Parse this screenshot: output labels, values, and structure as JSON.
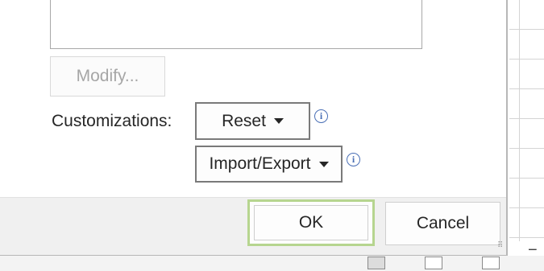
{
  "dialog": {
    "modify_button": "Modify...",
    "customizations_label": "Customizations:",
    "reset_button": "Reset",
    "import_export_button": "Import/Export",
    "ok_button": "OK",
    "cancel_button": "Cancel"
  },
  "icons": {
    "info": "info-icon",
    "dropdown": "caret-down-icon",
    "resize": "resize-grip-icon"
  },
  "colors": {
    "ok_focus_border": "#b6d58f",
    "info_icon": "#4a6fb5",
    "footer_bg": "#f0f0f0",
    "disabled_text": "#a6a6a6"
  }
}
